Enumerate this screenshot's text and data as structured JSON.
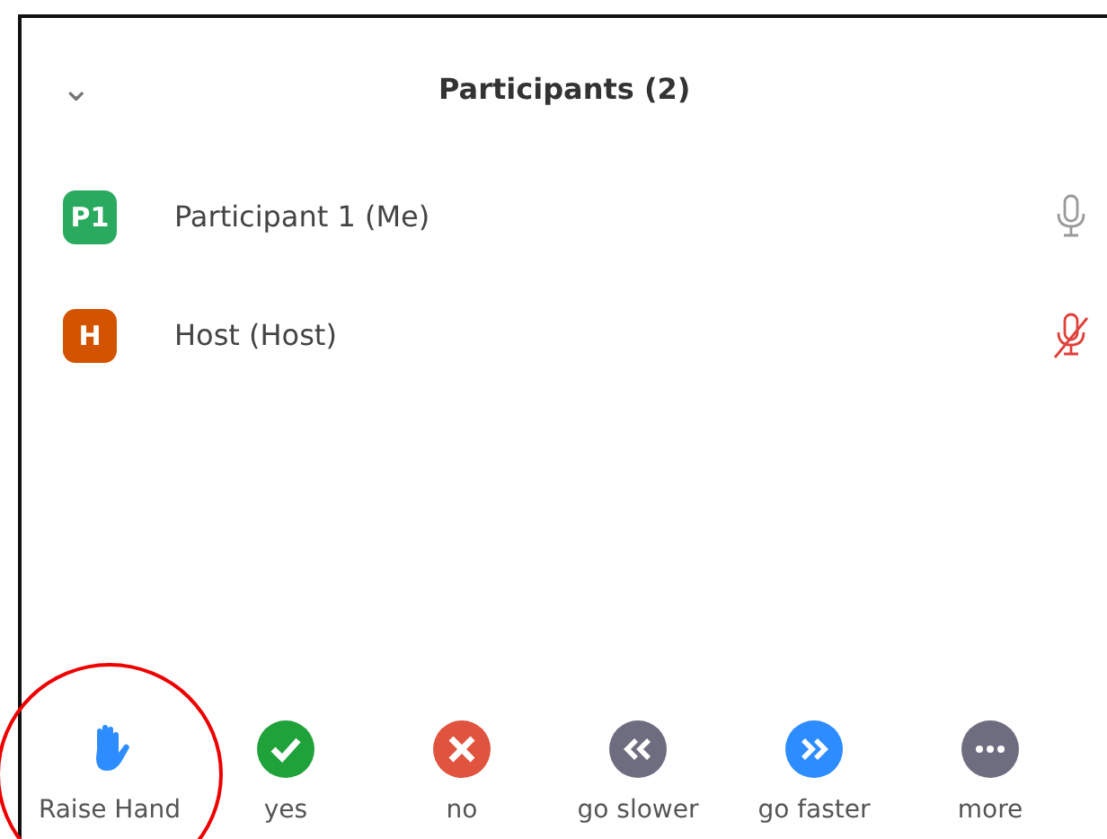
{
  "panel": {
    "title": "Participants (2)",
    "collapse_icon": "⌄"
  },
  "participants": [
    {
      "avatar": "P1",
      "color": "#2aaa5e",
      "name": "Participant 1 (Me)",
      "muted": false
    },
    {
      "avatar": "H",
      "color": "#d35400",
      "name": "Host (Host)",
      "muted": true
    }
  ],
  "reactions": [
    {
      "kind": "hand",
      "color": "#2d8cff",
      "label": "Raise Hand",
      "circled": true
    },
    {
      "kind": "check",
      "color": "#1fa23a",
      "label": "yes",
      "circled": false
    },
    {
      "kind": "cross",
      "color": "#e0533f",
      "label": "no",
      "circled": false
    },
    {
      "kind": "rewind",
      "color": "#6e6d80",
      "label": "go slower",
      "circled": false
    },
    {
      "kind": "forward",
      "color": "#2d8cff",
      "label": "go faster",
      "circled": false
    },
    {
      "kind": "dots",
      "color": "#6e6d80",
      "label": "more",
      "circled": false
    }
  ]
}
